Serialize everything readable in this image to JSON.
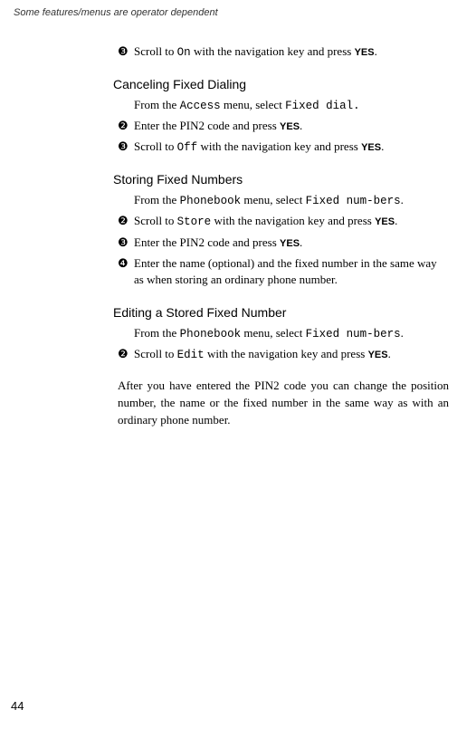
{
  "header_note": "Some features/menus are operator dependent",
  "page_number": "44",
  "bullets": {
    "b2": "❷",
    "b3": "❸",
    "b4": "❹"
  },
  "section0": {
    "step3_a": "Scroll to ",
    "step3_mono": "On",
    "step3_b": " with the navigation key and press ",
    "step3_yes": "YES",
    "step3_c": "."
  },
  "section1": {
    "heading": "Canceling Fixed Dialing",
    "intro_a": "From the ",
    "intro_mono1": "Access",
    "intro_b": " menu, select ",
    "intro_mono2": "Fixed dial.",
    "step2_a": "Enter the PIN2 code and press ",
    "step2_yes": "YES",
    "step2_b": ".",
    "step3_a": "Scroll to ",
    "step3_mono": "Off",
    "step3_b": " with the navigation key and press ",
    "step3_yes": "YES",
    "step3_c": "."
  },
  "section2": {
    "heading": "Storing Fixed Numbers",
    "intro_a": "From the ",
    "intro_mono1": "Phonebook",
    "intro_b": " menu, select ",
    "intro_mono2": "Fixed num-bers",
    "intro_c": ".",
    "step2_a": "Scroll to ",
    "step2_mono": "Store",
    "step2_b": " with the navigation key and press ",
    "step2_yes": "YES",
    "step2_c": ".",
    "step3_a": "Enter the PIN2 code and press ",
    "step3_yes": "YES",
    "step3_b": ".",
    "step4": "Enter the name (optional) and the fixed number in the same way as when storing an ordinary phone number."
  },
  "section3": {
    "heading": "Editing a Stored Fixed Number",
    "intro_a": "From the ",
    "intro_mono1": "Phonebook",
    "intro_b": " menu, select ",
    "intro_mono2": "Fixed num-bers",
    "intro_c": ".",
    "step2_a": "Scroll to ",
    "step2_mono": "Edit",
    "step2_b": " with the navigation key and press ",
    "step2_yes": "YES",
    "step2_c": "."
  },
  "closing_paragraph": "After you have entered the PIN2 code you can change the position number, the name or the fixed number in the same way as with an ordinary phone number."
}
